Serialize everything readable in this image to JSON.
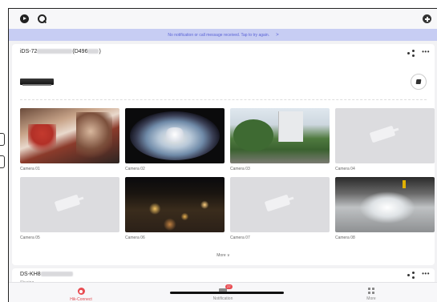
{
  "notice": {
    "text": "No notification or call message received. Tap to try again.",
    "chevron": ">"
  },
  "devices": [
    {
      "name_prefix": "iDS-72",
      "name_suffix": "(D496",
      "name_close": ")",
      "more_label": "•••",
      "cameras": [
        {
          "label": "Camera 01",
          "has_image": true
        },
        {
          "label": "Camera 02",
          "has_image": true
        },
        {
          "label": "Camera 03",
          "has_image": true
        },
        {
          "label": "Camera 04",
          "has_image": false
        },
        {
          "label": "Camera 05",
          "has_image": false
        },
        {
          "label": "Camera 06",
          "has_image": true
        },
        {
          "label": "Camera 07",
          "has_image": false
        },
        {
          "label": "Camera 08",
          "has_image": true
        }
      ],
      "expand_label": "More ∨"
    },
    {
      "name_prefix": "DS-KH8",
      "status": "Sharing",
      "more_label": "•••"
    }
  ],
  "tabs": {
    "connect": "Hik-Connect",
    "notification": "Notification",
    "notification_badge": "27",
    "more": "More"
  },
  "colors": {
    "accent": "#e84c52",
    "notice_bg": "#c7cdf3",
    "notice_text": "#5b63d6"
  },
  "icons": {
    "top_left": [
      "play-icon",
      "search-icon"
    ],
    "top_right": "add-icon",
    "card": [
      "share-icon",
      "more-icon",
      "record-icon"
    ]
  }
}
